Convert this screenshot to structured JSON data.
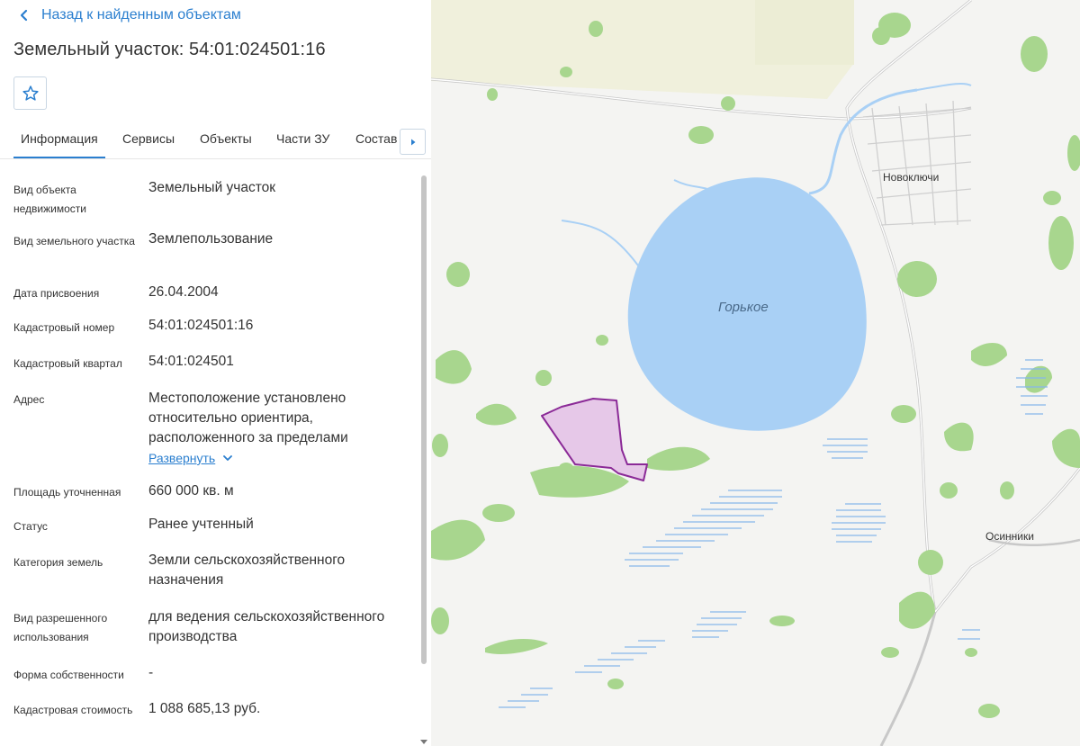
{
  "header": {
    "back_label": "Назад к найденным объектам",
    "title": "Земельный участок: 54:01:024501:16"
  },
  "tabs": [
    {
      "label": "Информация"
    },
    {
      "label": "Сервисы"
    },
    {
      "label": "Объекты"
    },
    {
      "label": "Части ЗУ"
    },
    {
      "label": "Состав"
    }
  ],
  "details": {
    "object_type": {
      "label": "Вид объекта недвижимости",
      "value": "Земельный участок"
    },
    "parcel_type": {
      "label": "Вид земельного участка",
      "value": "Землепользование"
    },
    "assigned_date": {
      "label": "Дата присвоения",
      "value": "26.04.2004"
    },
    "cadastral_number": {
      "label": "Кадастровый номер",
      "value": "54:01:024501:16"
    },
    "cadastral_quarter": {
      "label": "Кадастровый квартал",
      "value": "54:01:024501"
    },
    "address": {
      "label": "Адрес",
      "value": "Местоположение установлено относительно ориентира, расположенного за пределами",
      "expand_label": "Развернуть"
    },
    "area": {
      "label": "Площадь уточненная",
      "value": "660 000 кв. м"
    },
    "status": {
      "label": "Статус",
      "value": "Ранее учтенный"
    },
    "land_category": {
      "label": "Категория земель",
      "value": "Земли сельскохозяйственного назначения"
    },
    "permitted_use": {
      "label": "Вид разрешенного использования",
      "value": "для ведения сельскохозяйственного производства"
    },
    "ownership": {
      "label": "Форма собственности",
      "value": "-"
    },
    "cadastral_value": {
      "label": "Кадастровая стоимость",
      "value": "1 088 685,13 руб."
    }
  },
  "map": {
    "lake_label": "Горькое",
    "village_1": "Новоключи",
    "village_2": "Осинники"
  },
  "colors": {
    "accent": "#2b7fcf",
    "lake": "#a9d0f5",
    "forest": "#a8d68e",
    "parcel_fill": "#e6c8e8",
    "parcel_stroke": "#8b2a97"
  },
  "icons": {
    "back": "chevron-left-icon",
    "favorite": "star-icon",
    "tabs_next": "caret-right-icon",
    "expand": "chevron-down-icon"
  }
}
